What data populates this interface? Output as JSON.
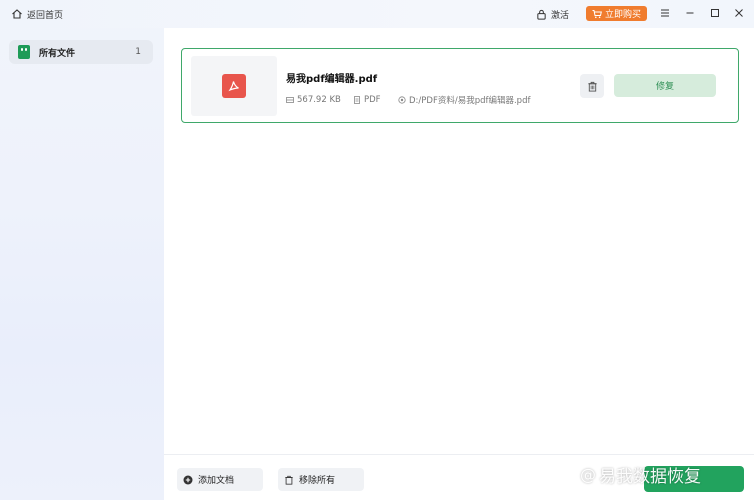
{
  "titlebar": {
    "back_label": "返回首页",
    "activate_label": "激活",
    "buy_label": "立即购买"
  },
  "sidebar": {
    "items": [
      {
        "label": "所有文件",
        "count": "1"
      }
    ]
  },
  "file": {
    "name": "易我pdf编辑器.pdf",
    "size": "567.92 KB",
    "type": "PDF",
    "path": "D:/PDF资料/易我pdf编辑器.pdf",
    "repair_label": "修复"
  },
  "bottom": {
    "add_label": "添加文档",
    "remove_all_label": "移除所有"
  },
  "watermark": {
    "text": "易我数据恢复"
  },
  "colors": {
    "accent_green": "#22a35e",
    "buy_orange": "#f07c2e",
    "pdf_red": "#e8554c"
  }
}
